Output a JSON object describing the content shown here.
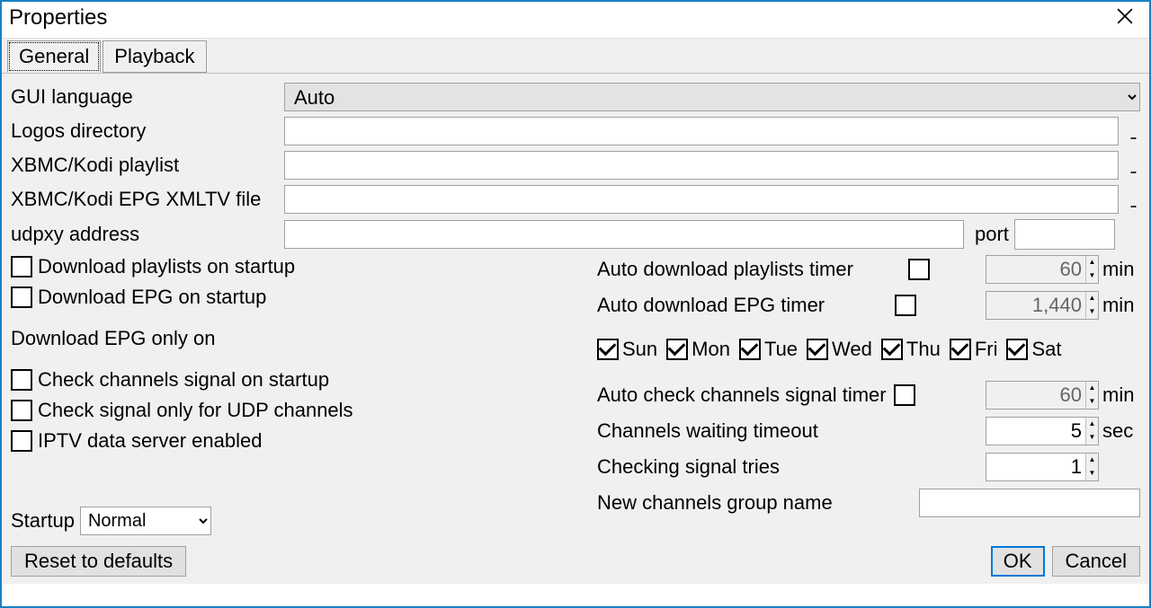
{
  "window": {
    "title": "Properties"
  },
  "tabs": {
    "general": "General",
    "playback": "Playback"
  },
  "labels": {
    "gui_language": "GUI language",
    "logos_dir": "Logos directory",
    "kodi_playlist": "XBMC/Kodi playlist",
    "kodi_epg": "XBMC/Kodi EPG XMLTV file",
    "udpxy": "udpxy address",
    "port": "port",
    "dl_playlists_startup": "Download playlists on startup",
    "dl_epg_startup": "Download EPG on startup",
    "dl_epg_only_on": "Download EPG only on",
    "check_signal_startup": "Check channels signal on startup",
    "check_signal_udp": "Check signal only for UDP channels",
    "iptv_server": "IPTV data server enabled",
    "startup": "Startup",
    "auto_dl_playlists": "Auto download playlists timer",
    "auto_dl_epg": "Auto download EPG timer",
    "auto_check_signal": "Auto check channels signal timer",
    "channels_timeout": "Channels waiting timeout",
    "checking_tries": "Checking signal tries",
    "new_channels_group": "New channels group name",
    "min": "min",
    "sec": "sec"
  },
  "values": {
    "gui_language": "Auto",
    "logos_dir": "",
    "kodi_playlist": "",
    "kodi_epg": "",
    "udpxy_addr": "",
    "udpxy_port": "",
    "startup": "Normal",
    "auto_dl_playlists_timer": "60",
    "auto_dl_epg_timer": "1,440",
    "auto_check_signal_timer": "60",
    "channels_timeout": "5",
    "checking_tries": "1",
    "new_channels_group": ""
  },
  "days": {
    "sun": "Sun",
    "mon": "Mon",
    "tue": "Tue",
    "wed": "Wed",
    "thu": "Thu",
    "fri": "Fri",
    "sat": "Sat"
  },
  "buttons": {
    "reset": "Reset to defaults",
    "ok": "OK",
    "cancel": "Cancel"
  }
}
